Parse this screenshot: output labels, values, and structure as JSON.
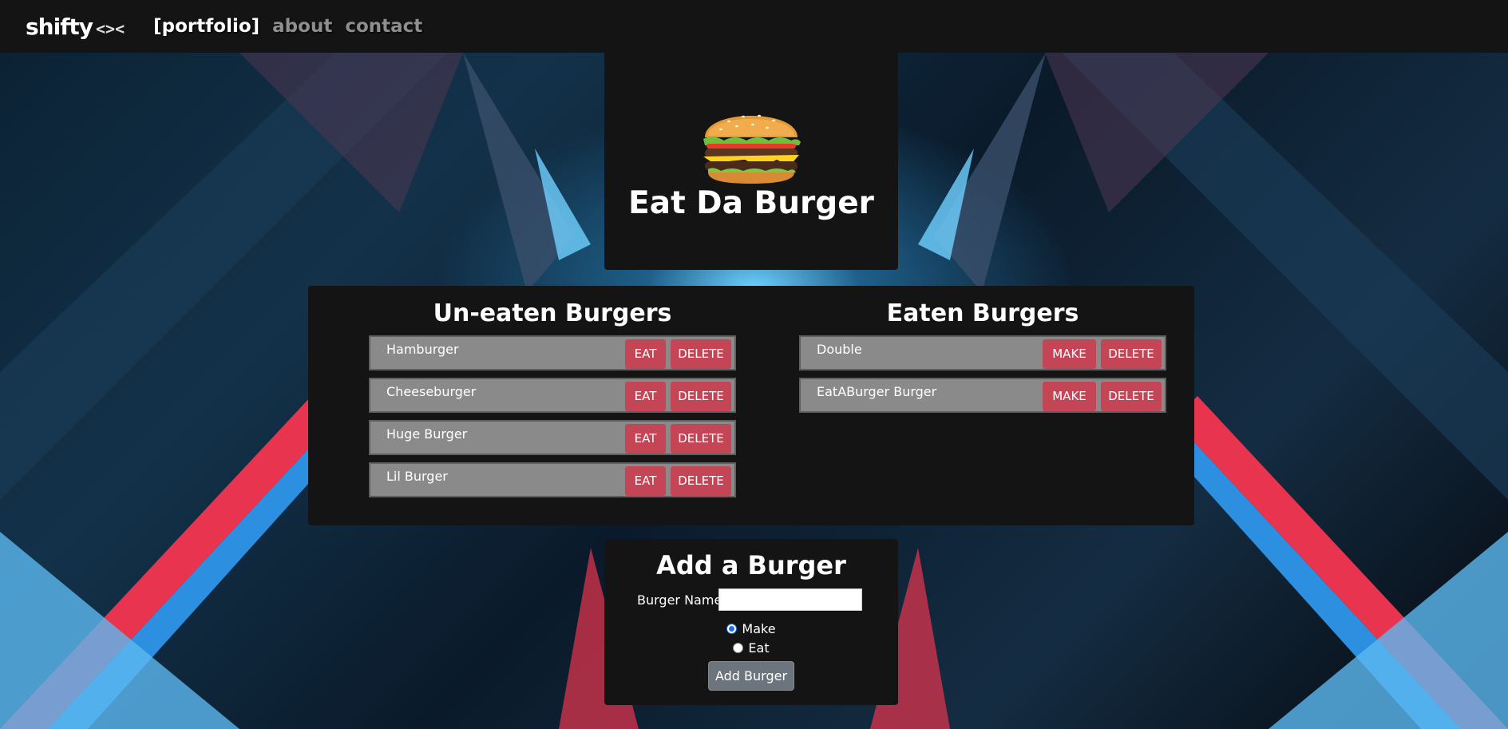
{
  "nav": {
    "brand": "shifty",
    "brand_mark": "<><",
    "links": [
      "[portfolio]",
      "about",
      "contact"
    ]
  },
  "header": {
    "title": "Eat Da Burger",
    "icon": "burger-icon"
  },
  "uneaten": {
    "title": "Un-eaten Burgers",
    "items": [
      {
        "name": "Hamburger",
        "eat": "EAT",
        "delete": "DELETE"
      },
      {
        "name": "Cheeseburger",
        "eat": "EAT",
        "delete": "DELETE"
      },
      {
        "name": "Huge Burger",
        "eat": "EAT",
        "delete": "DELETE"
      },
      {
        "name": "Lil Burger",
        "eat": "EAT",
        "delete": "DELETE"
      }
    ]
  },
  "eaten": {
    "title": "Eaten Burgers",
    "items": [
      {
        "name": "Double",
        "make": "MAKE",
        "delete": "DELETE"
      },
      {
        "name": "EatABurger Burger",
        "make": "MAKE",
        "delete": "DELETE"
      }
    ]
  },
  "add_form": {
    "title": "Add a Burger",
    "name_label": "Burger Name:",
    "name_value": "",
    "options": [
      {
        "label": "Make",
        "checked": true
      },
      {
        "label": "Eat",
        "checked": false
      }
    ],
    "submit": "Add Burger"
  },
  "colors": {
    "accent": "#c44656",
    "panel": "#141414",
    "row": "#8a8a8a"
  }
}
